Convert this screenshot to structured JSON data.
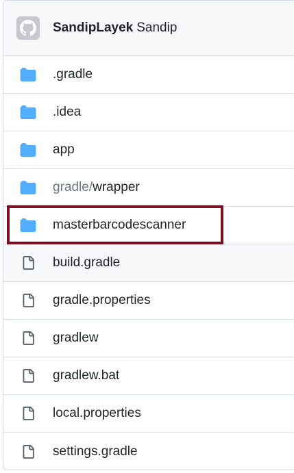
{
  "header": {
    "owner": "SandipLayek",
    "commit_message": "Sandip",
    "avatar_icon": "github-avatar-icon"
  },
  "files": [
    {
      "type": "folder",
      "name": ".gradle",
      "icon": "folder-icon"
    },
    {
      "type": "folder",
      "name": ".idea",
      "icon": "folder-icon"
    },
    {
      "type": "folder",
      "name": "app",
      "icon": "folder-icon"
    },
    {
      "type": "folder",
      "prefix": "gradle/",
      "name": "wrapper",
      "icon": "folder-icon"
    },
    {
      "type": "folder",
      "name": "masterbarcodescanner",
      "icon": "folder-icon",
      "highlighted": true
    },
    {
      "type": "file",
      "name": "build.gradle",
      "icon": "file-icon"
    },
    {
      "type": "file",
      "name": "gradle.properties",
      "icon": "file-icon"
    },
    {
      "type": "file",
      "name": "gradlew",
      "icon": "file-icon"
    },
    {
      "type": "file",
      "name": "gradlew.bat",
      "icon": "file-icon"
    },
    {
      "type": "file",
      "name": "local.properties",
      "icon": "file-icon"
    },
    {
      "type": "file",
      "name": "settings.gradle",
      "icon": "file-icon"
    }
  ],
  "colors": {
    "folder": "#54aeff",
    "file": "#57606a",
    "highlight_border": "#7b1022"
  }
}
